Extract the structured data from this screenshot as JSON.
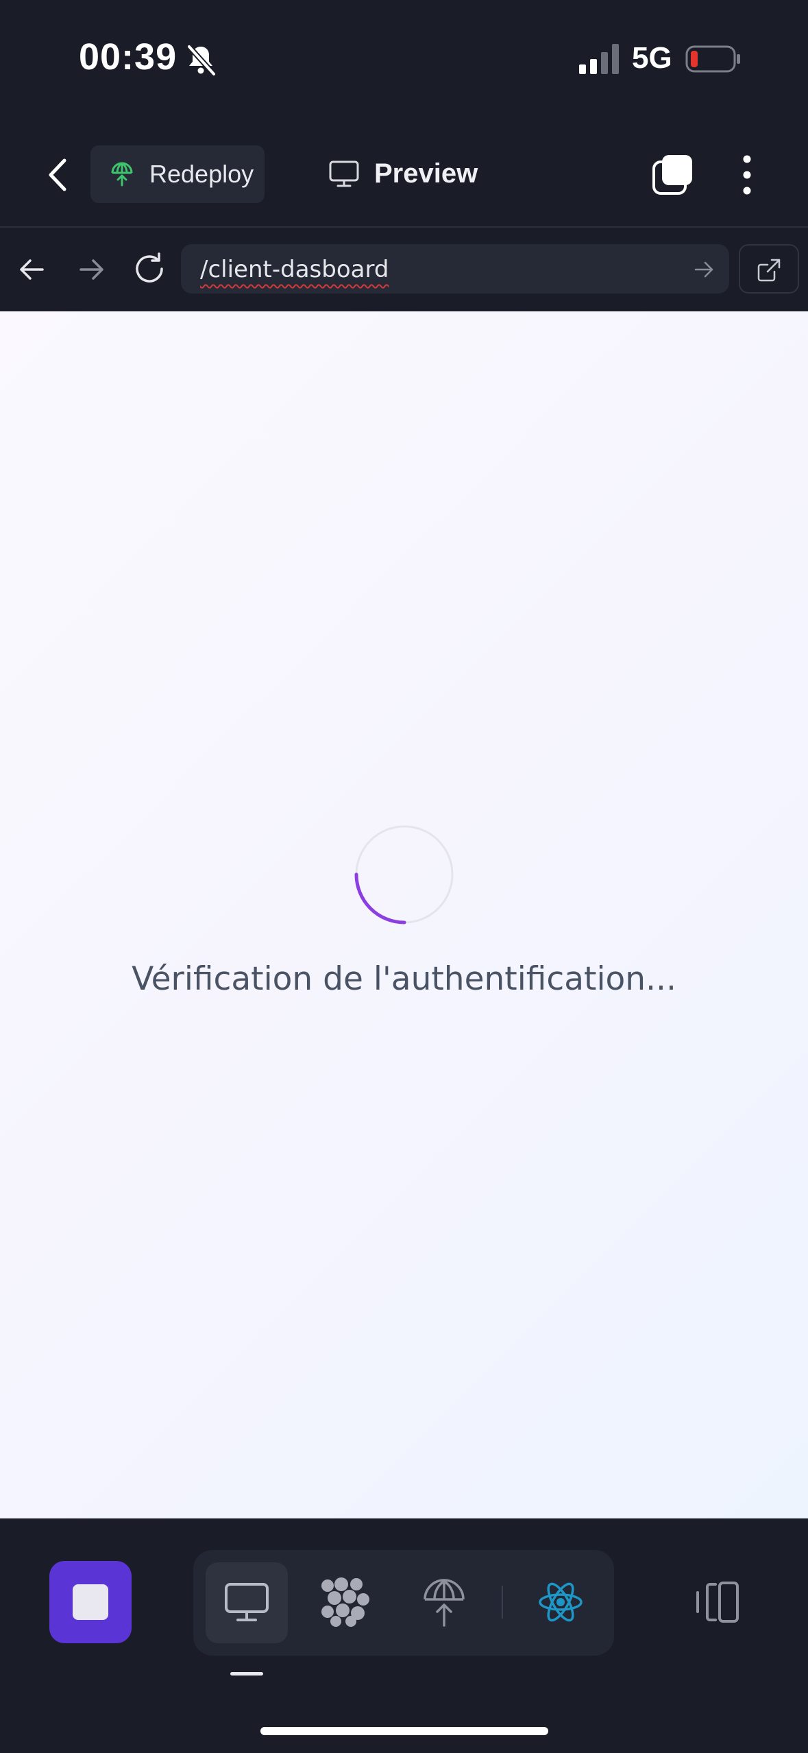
{
  "status_bar": {
    "time": "00:39",
    "network": "5G",
    "icons": [
      "bell-slash-icon",
      "signal-icon",
      "battery-low-icon"
    ]
  },
  "app_bar": {
    "redeploy_label": "Redeploy",
    "preview_label": "Preview",
    "icons": [
      "back-chevron-icon",
      "deploy-icon",
      "monitor-icon",
      "tabs-icon",
      "more-vertical-icon"
    ]
  },
  "browser": {
    "url": "/client-dasboard",
    "icons": [
      "arrow-left-icon",
      "arrow-right-icon",
      "reload-icon",
      "go-arrow-icon",
      "external-link-icon"
    ]
  },
  "page": {
    "loading_text": "Vérification de l'authentification..."
  },
  "bottom_toolbar": {
    "icons": [
      "stop-icon",
      "monitor-icon",
      "grid-dots-icon",
      "deploy-icon",
      "react-icon",
      "panel-icon"
    ],
    "active_index": 0
  },
  "colors": {
    "background": "#1a1d28",
    "accent": "#5b34d6",
    "spinner": "#8b3fe0",
    "react": "#1e96c8",
    "deploy_green": "#3ec46d",
    "battery_red": "#e5342b"
  }
}
